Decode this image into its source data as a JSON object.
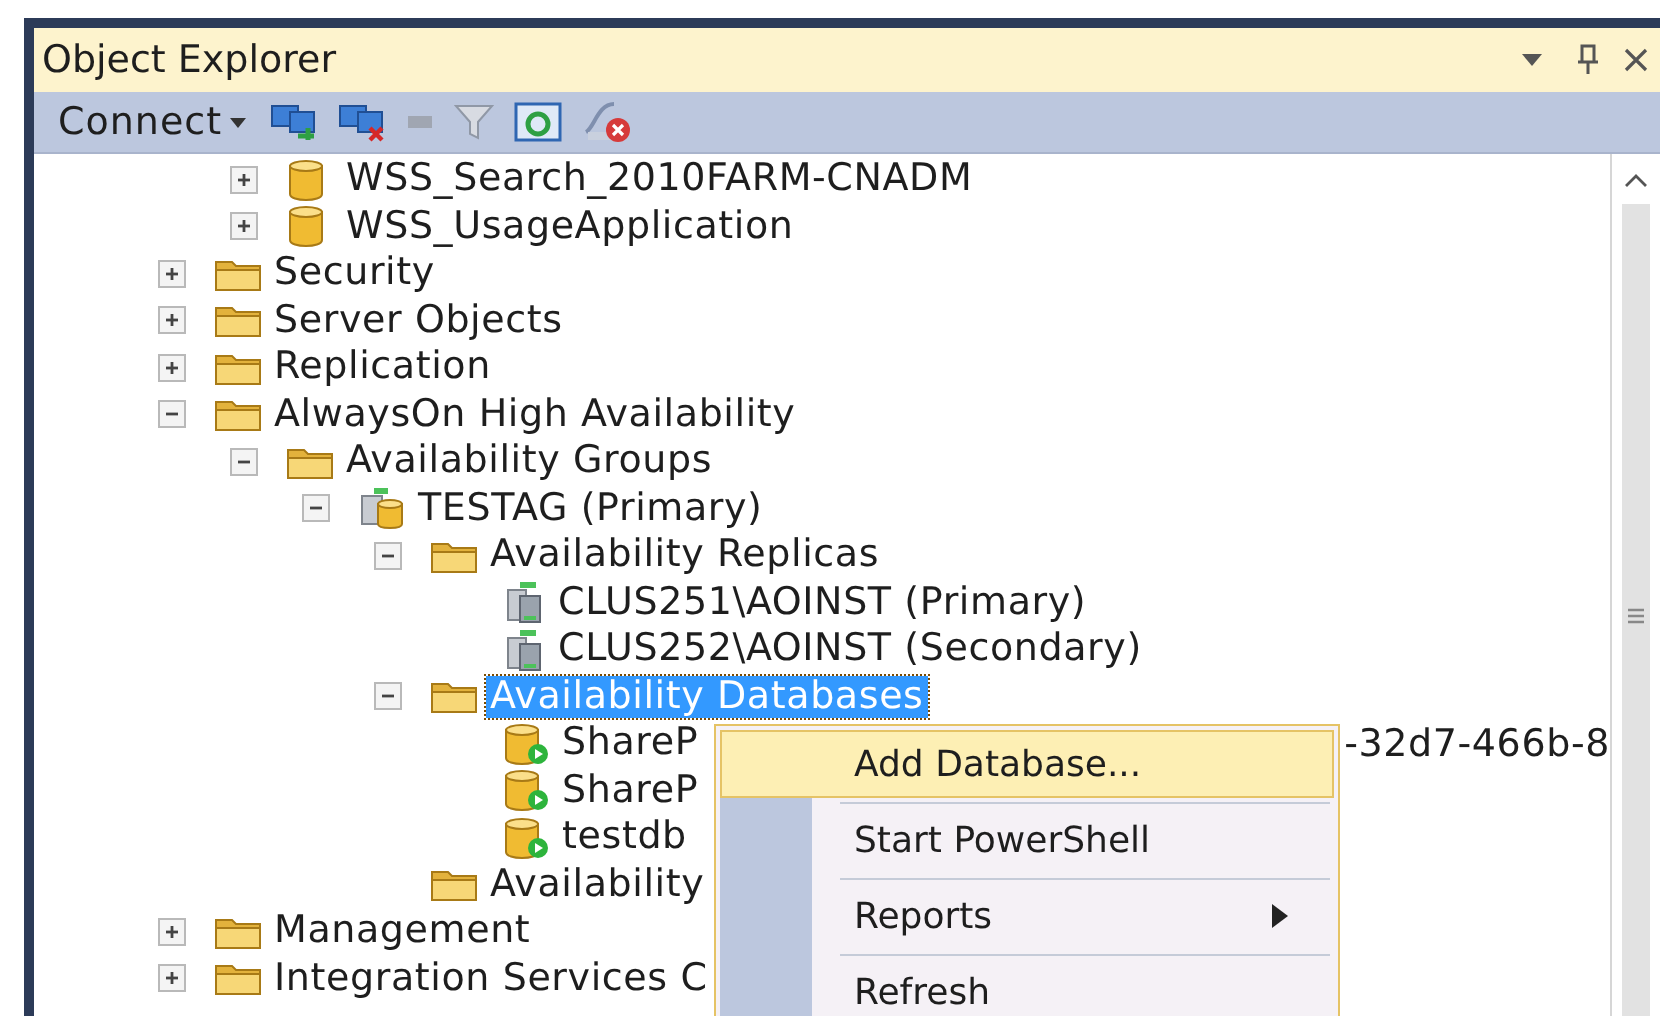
{
  "panel": {
    "title": "Object Explorer"
  },
  "toolbar": {
    "connect_label": "Connect"
  },
  "tree": {
    "continued_children": [
      {
        "label": "WSS_Search_2010FARM-CNADM",
        "kind": "database",
        "expanded": false,
        "selected": false
      },
      {
        "label": "WSS_UsageApplication",
        "kind": "database",
        "expanded": false,
        "selected": false
      }
    ],
    "items": [
      {
        "label": "Security",
        "kind": "folder",
        "expanded": false,
        "selected": false
      },
      {
        "label": "Server Objects",
        "kind": "folder",
        "expanded": false,
        "selected": false
      },
      {
        "label": "Replication",
        "kind": "folder",
        "expanded": false,
        "selected": false
      },
      {
        "label": "AlwaysOn High Availability",
        "kind": "folder",
        "expanded": true,
        "selected": false,
        "children": [
          {
            "label": "Availability Groups",
            "kind": "folder",
            "expanded": true,
            "selected": false,
            "children": [
              {
                "label": "TESTAG (Primary)",
                "kind": "availability-group",
                "expanded": true,
                "selected": false,
                "children": [
                  {
                    "label": "Availability Replicas",
                    "kind": "folder",
                    "expanded": true,
                    "selected": false,
                    "children": [
                      {
                        "label": "CLUS251\\AOINST (Primary)",
                        "kind": "server",
                        "selected": false
                      },
                      {
                        "label": "CLUS252\\AOINST (Secondary)",
                        "kind": "server",
                        "selected": false
                      }
                    ]
                  },
                  {
                    "label": "Availability Databases",
                    "kind": "folder",
                    "expanded": true,
                    "selected": true,
                    "children": [
                      {
                        "label": "ShareP",
                        "label_tail": "-32d7-466b-8",
                        "kind": "synced-database",
                        "selected": false
                      },
                      {
                        "label": "ShareP",
                        "kind": "synced-database",
                        "selected": false
                      },
                      {
                        "label": "testdb",
                        "kind": "synced-database",
                        "selected": false
                      }
                    ]
                  },
                  {
                    "label": "Availability",
                    "kind": "folder",
                    "selected": false
                  }
                ]
              }
            ]
          }
        ]
      },
      {
        "label": "Management",
        "kind": "folder",
        "expanded": false,
        "selected": false
      },
      {
        "label": "Integration Services C",
        "kind": "folder",
        "expanded": false,
        "selected": false
      }
    ]
  },
  "context_menu": {
    "items": [
      {
        "label": "Add Database...",
        "selected": true,
        "submenu": false
      },
      {
        "label": "Start PowerShell",
        "selected": false,
        "submenu": false
      },
      {
        "label": "Reports",
        "selected": false,
        "submenu": true
      },
      {
        "label": "Refresh",
        "selected": false,
        "submenu": false
      }
    ]
  }
}
